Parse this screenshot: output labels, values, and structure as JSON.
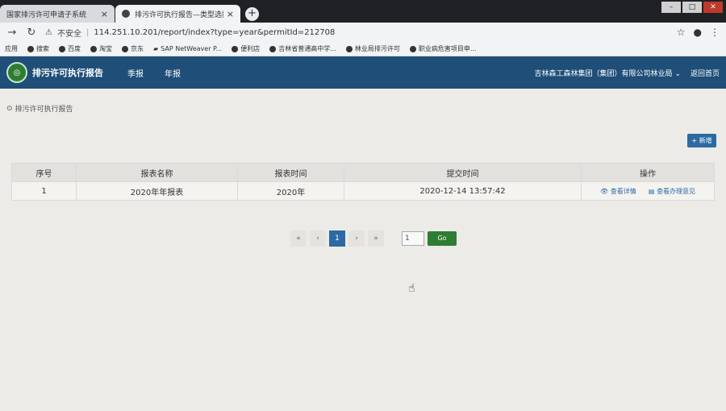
{
  "browser": {
    "tabs": [
      {
        "title": "国家排污许可申请子系统",
        "active": false
      },
      {
        "title": "排污许可执行报告—类型选择",
        "active": true
      }
    ],
    "new_tab": "+",
    "close_glyph": "×",
    "security_label": "不安全",
    "url": "114.251.10.201/report/index?type=year&permitId=212708",
    "bookmarks": [
      "应用",
      "搜索",
      "百度",
      "淘宝",
      "京东",
      "SAP NetWeaver P...",
      "便利店",
      "吉林省普通高中学...",
      "林业局排污许可",
      "职业病危害项目申..."
    ]
  },
  "app": {
    "title": "排污许可执行报告",
    "menu": [
      "季报",
      "年报"
    ],
    "company": "吉林森工森林集团（集团）有限公司林业局",
    "home_link": "返回首页"
  },
  "breadcrumb": "排污许可执行报告",
  "add_button": "+ 新增",
  "table": {
    "headers": [
      "序号",
      "报表名称",
      "报表时间",
      "提交时间",
      "操作"
    ],
    "rows": [
      {
        "index": "1",
        "name": "2020年年报表",
        "period": "2020年",
        "submitted": "2020-12-14 13:57:42",
        "ops": [
          "查看详情",
          "查看办理意见"
        ]
      }
    ]
  },
  "pager": {
    "first": "«",
    "prev": "‹",
    "current": "1",
    "next": "›",
    "last": "»",
    "input_value": "1",
    "go_label": "Go"
  },
  "colors": {
    "header_bg": "#1f4e79",
    "primary": "#2d6aa3",
    "go_green": "#2e7d32"
  }
}
